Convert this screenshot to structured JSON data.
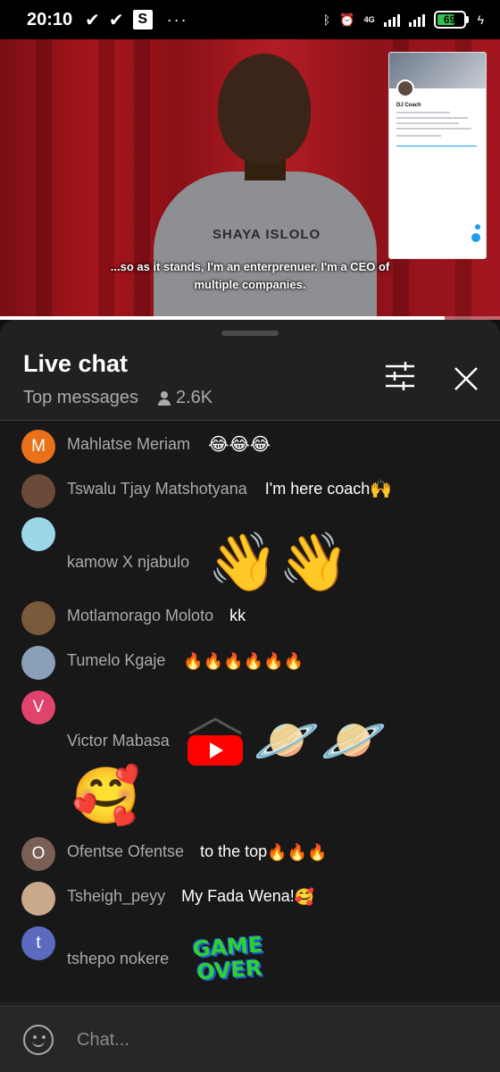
{
  "status_bar": {
    "time": "20:10",
    "network_label": "4G",
    "battery": "69",
    "battery_level": 0.69
  },
  "video": {
    "caption_line1": "...so as it stands, I'm an enterprenuer. I'm a CEO of",
    "caption_line2": "multiple companies.",
    "shirt_text": "SHAYA ISLOLO",
    "pip_name": "DJ Coach",
    "progress": 0.89
  },
  "chat": {
    "title": "Live chat",
    "mode": "Top messages",
    "viewers": "2.6K",
    "input_placeholder": "Chat..."
  },
  "messages": [
    {
      "author": "Mahlatse Meriam",
      "text": "",
      "emoji": "😂😂😂",
      "avatar_letter": "M",
      "avatar_color": "#e8711a"
    },
    {
      "author": "Tswalu Tjay Matshotyana",
      "text": "I'm here coach",
      "emoji": "🙌",
      "avatar_letter": "",
      "avatar_color": "#6b4a3a"
    },
    {
      "author": "kamow X njabulo",
      "text": "",
      "emoji": "👋👋",
      "avatar_letter": "",
      "avatar_color": "#9ad7e8"
    },
    {
      "author": "Motlamorago Moloto",
      "text": "kk",
      "emoji": "",
      "avatar_letter": "",
      "avatar_color": "#7a5a3a"
    },
    {
      "author": "Tumelo Kgaje",
      "text": "",
      "emoji": "🔥🔥🔥🔥🔥🔥",
      "avatar_letter": "",
      "avatar_color": "#8aa0b8"
    },
    {
      "author": "Victor Mabasa",
      "text": "",
      "emoji": "🪐🪐",
      "avatar_letter": "V",
      "avatar_color": "#e0436b"
    },
    {
      "author": "Ofentse Ofentse",
      "text": "to the top",
      "emoji": "🔥🔥🔥",
      "avatar_letter": "O",
      "avatar_color": "#7a5f55"
    },
    {
      "author": "Tsheigh_peyy",
      "text": "My Fada Wena!",
      "emoji": "🥰",
      "avatar_letter": "",
      "avatar_color": "#c9a98a"
    },
    {
      "author": "tshepo nokere",
      "text": "",
      "emoji": "",
      "avatar_letter": "t",
      "avatar_color": "#5c6bc0"
    }
  ],
  "stickers": {
    "victor_extra": "🥰",
    "game_over": "GAME OVER"
  },
  "colors": {
    "panel_bg": "#212121",
    "messages_bg": "#181818",
    "author_text": "#aaaaaa",
    "youtube_red": "#ff0000",
    "battery_green": "#33c24d"
  }
}
